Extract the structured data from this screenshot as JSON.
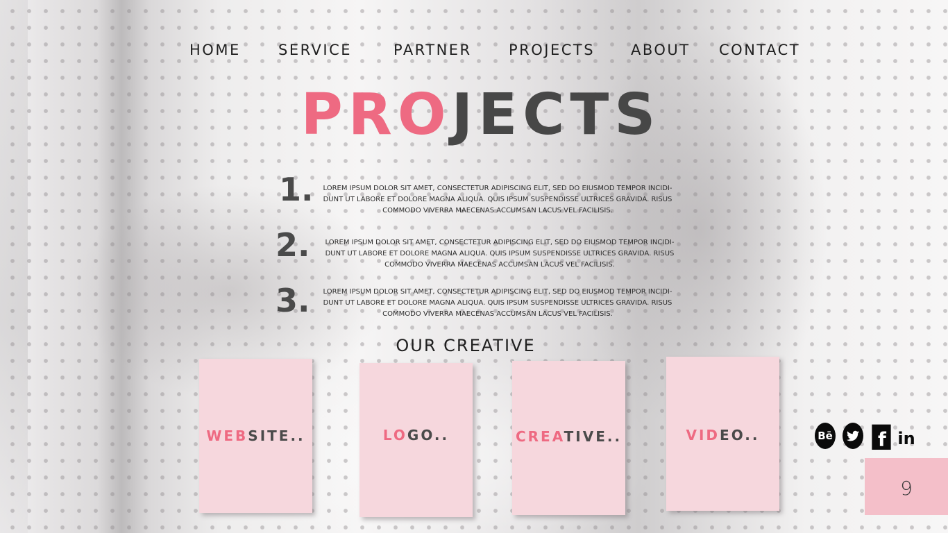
{
  "nav": {
    "items": [
      "HOME",
      "SERVICE",
      "PARTNER",
      "PROJECTS",
      "ABOUT",
      "CONTACT"
    ]
  },
  "title": {
    "part_accent": "PRO",
    "part_rest": "JECTS"
  },
  "projects": [
    {
      "number": "1.",
      "text": "LOREM IPSUM DOLOR SIT AMET, CONSECTETUR ADIPISCING ELIT, SED DO EIUSMOD TEMPOR INCIDI-DUNT UT LABORE ET DOLORE MAGNA ALIQUA. QUIS IPSUM SUSPENDISSE ULTRICES GRAVIDA. RISUS COMMODO VIVERRA MAECENAS ACCUMSAN LACUS VEL FACILISIS."
    },
    {
      "number": "2.",
      "text": "LOREM IPSUM DOLOR SIT AMET, CONSECTETUR ADIPISCING ELIT, SED DO EIUSMOD TEMPOR INCIDI-DUNT UT LABORE ET DOLORE MAGNA ALIQUA. QUIS IPSUM SUSPENDISSE ULTRICES GRAVIDA. RISUS COMMODO VIVERRA MAECENAS ACCUMSAN LACUS VEL FACILISIS."
    },
    {
      "number": "3.",
      "text": "LOREM IPSUM DOLOR SIT AMET, CONSECTETUR ADIPISCING ELIT, SED DO EIUSMOD TEMPOR INCIDI-DUNT UT LABORE ET DOLORE MAGNA ALIQUA. QUIS IPSUM SUSPENDISSE ULTRICES GRAVIDA. RISUS COMMODO VIVERRA MAECENAS ACCUMSAN LACUS VEL FACILISIS."
    }
  ],
  "section_title": "OUR CREATIVE",
  "cards": [
    {
      "accent": "WEB",
      "rest": "SITE.."
    },
    {
      "accent": "LO",
      "rest": "GO.."
    },
    {
      "accent": "CREA",
      "rest": "TIVE.."
    },
    {
      "accent": "VID",
      "rest": "EO.."
    }
  ],
  "social": {
    "behance_text": "Bē",
    "facebook_text": "f",
    "linkedin_text": "in",
    "icons": [
      "behance-icon",
      "twitter-icon",
      "facebook-icon",
      "linkedin-icon"
    ]
  },
  "page_number": "9",
  "colors": {
    "accent": "#ee6a82",
    "dark_text": "#474747",
    "card_bg": "#f6d7dd",
    "page_number_bg": "#f4bfc9"
  }
}
